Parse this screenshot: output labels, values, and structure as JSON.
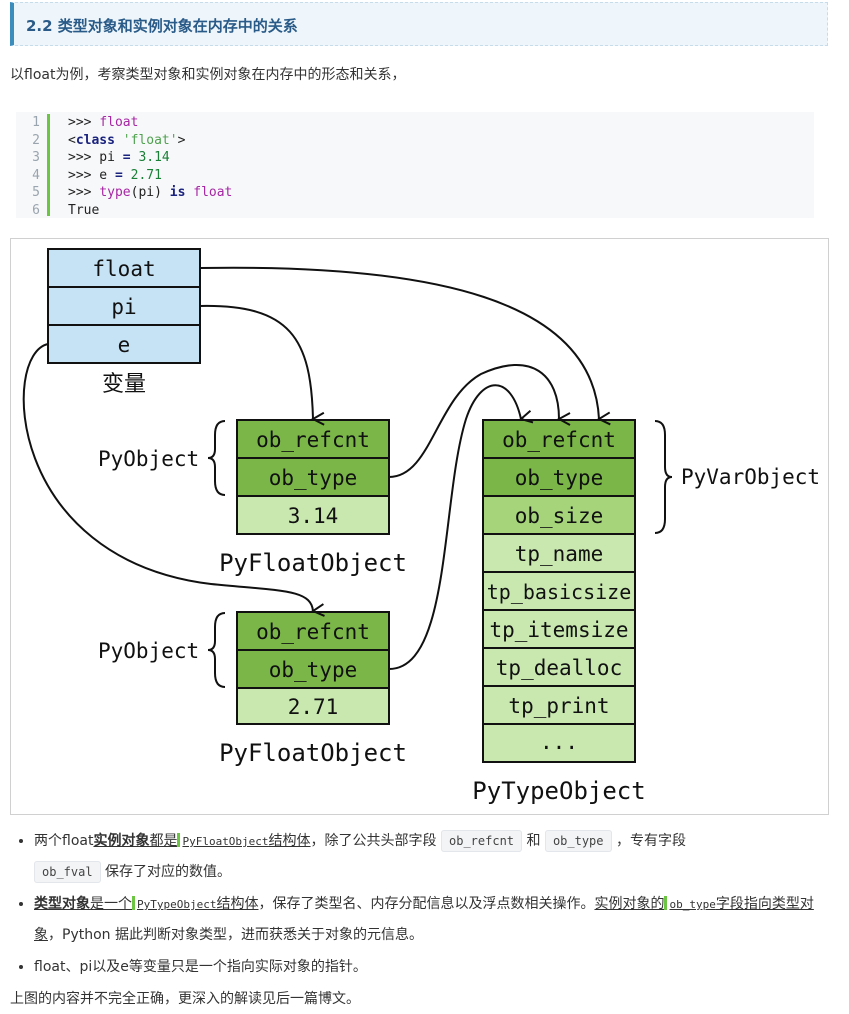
{
  "heading": "2.2 类型对象和实例对象在内存中的关系",
  "intro": "以float为例，考察类型对象和实例对象在内存中的形态和关系，",
  "code": {
    "line_numbers": [
      "1",
      "2",
      "3",
      "4",
      "5",
      "6"
    ],
    "l1": {
      "prompt": ">>> ",
      "name": "float"
    },
    "l2": {
      "a": "<",
      "kw": "class",
      "sp": " ",
      "str": "'float'",
      "b": ">"
    },
    "l3": {
      "a": ">>> pi ",
      "op": "=",
      "sp": " ",
      "num": "3.14"
    },
    "l4": {
      "a": ">>> e ",
      "op": "=",
      "sp": " ",
      "num": "2.71"
    },
    "l5": {
      "a": ">>> ",
      "fn": "type",
      "b": "(pi) ",
      "kw": "is",
      "sp": " ",
      "name": "float"
    },
    "l6": "True"
  },
  "figure": {
    "variables": [
      "float",
      "pi",
      "e"
    ],
    "variables_label": "变量",
    "pyobject_label": "PyObject",
    "float_obj_1": {
      "fields": [
        "ob_refcnt",
        "ob_type",
        "3.14"
      ],
      "label": "PyFloatObject"
    },
    "float_obj_2": {
      "fields": [
        "ob_refcnt",
        "ob_type",
        "2.71"
      ],
      "label": "PyFloatObject"
    },
    "type_obj": {
      "fields": [
        "ob_refcnt",
        "ob_type",
        "ob_size",
        "tp_name",
        "tp_basicsize",
        "tp_itemsize",
        "tp_dealloc",
        "tp_print",
        "..."
      ],
      "label": "PyTypeObject"
    },
    "pyvarobject_label": "PyVarObject",
    "colors": {
      "variable": "#c6e2f5",
      "header_dark": "#7ab648",
      "header_light": "#a5d47b",
      "body": "#c9e8b0"
    }
  },
  "bullets": {
    "b1": {
      "t1": "两个float",
      "t2": "实例对象",
      "t3": "都是",
      "code1": "PyFloatObject",
      "t4": "结构体",
      "t5": "，除了公共头部字段 ",
      "code2": "ob_refcnt",
      "t6": " 和 ",
      "code3": "ob_type",
      "t7": " ，专有字段",
      "code4": "ob_fval",
      "t8": " 保存了对应的数值。"
    },
    "b2": {
      "t1": "类型对象",
      "t2": "是一个",
      "code1": "PyTypeObject",
      "t3": "结构体",
      "t4": "，保存了类型名、内存分配信息以及浮点数相关操作。",
      "t5": "实例对象的",
      "code2": "ob_type",
      "t6": "字段指向类型对象",
      "t7": "，Python 据此判断对象类型，进而获悉关于对象的元信息。"
    },
    "b3": "float、pi以及e等变量只是一个指向实际对象的指针。"
  },
  "footer": "上图的内容并不完全正确，更深入的解读见后一篇博文。"
}
